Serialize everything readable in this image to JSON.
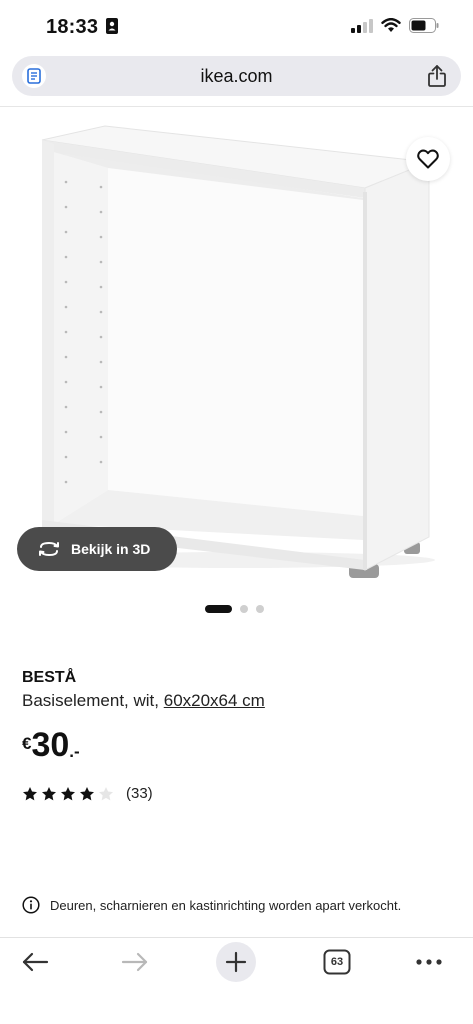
{
  "status_bar": {
    "time": "18:33"
  },
  "browser": {
    "url": "ikea.com",
    "tabs_count": "63"
  },
  "product": {
    "brand": "BESTÅ",
    "description": "Basiselement, wit,",
    "size_link": "60x20x64 cm",
    "price_currency": "€",
    "price_value": "30",
    "price_suffix": ".-",
    "rating_stars": 4,
    "rating_max": 5,
    "rating_count": "(33)",
    "view_3d_label": "Bekijk in 3D",
    "notice": "Deuren, scharnieren en kastinrichting worden apart verkocht.",
    "image_carousel": {
      "active_index": 0,
      "total": 3
    }
  },
  "colors": {
    "accent_dark": "#111111",
    "button_3d_bg": "#4b4b4b",
    "url_bar_bg": "#e9e9ee",
    "disabled_icon": "#b8b8b8"
  },
  "icons": {
    "reader": "reader-icon",
    "share": "share-icon",
    "favorite": "heart-icon",
    "rotate_3d": "rotate-icon",
    "info": "info-icon",
    "back": "arrow-left-icon",
    "forward": "arrow-right-icon",
    "new_tab": "plus-icon",
    "tabs": "tabs-icon",
    "more": "more-icon"
  }
}
